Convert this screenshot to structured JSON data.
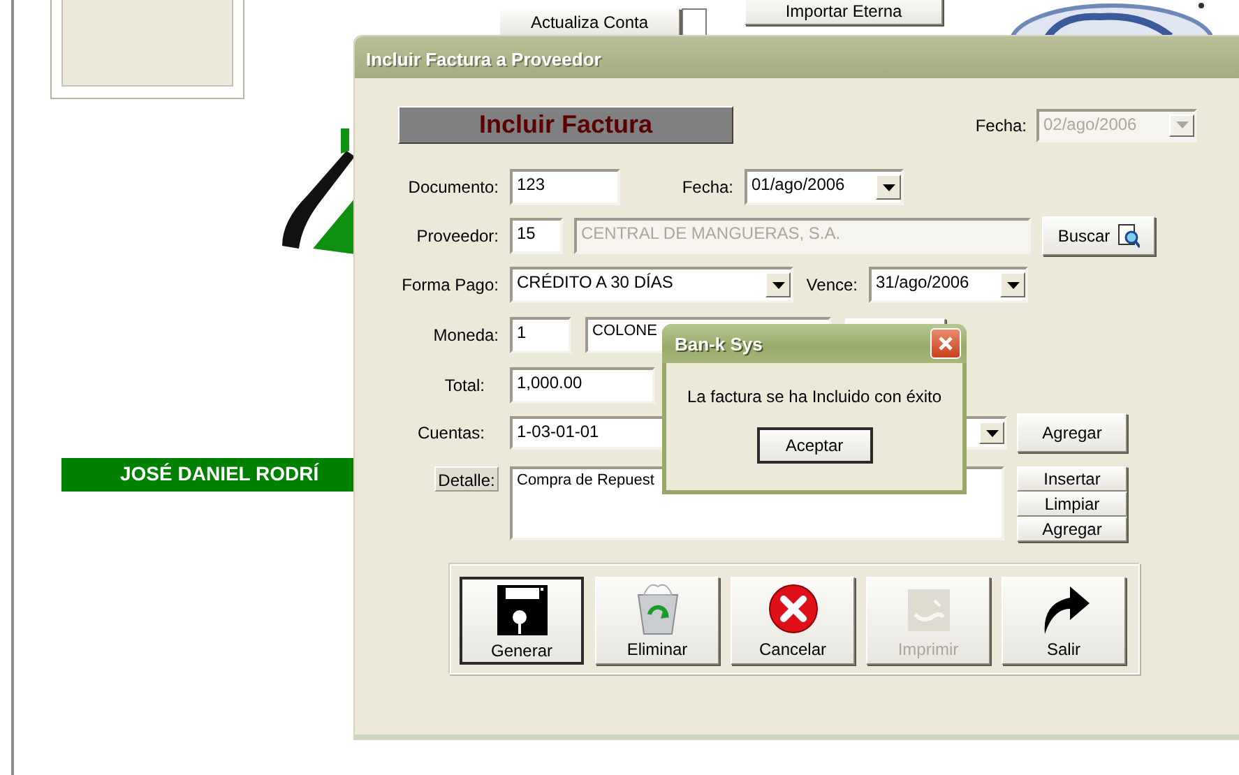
{
  "background": {
    "buttons": [
      "Actualiza Conta",
      "Importar Eterna"
    ],
    "user_name": "JOSÉ DANIEL RODRÍ"
  },
  "dialog": {
    "title": "Incluir Factura a Proveedor",
    "active": false,
    "heading": "Incluir Factura",
    "date": {
      "label": "Fecha:",
      "value": "02/ago/2006",
      "disabled": true
    },
    "documento": {
      "label": "Documento:",
      "value": "123"
    },
    "fecha": {
      "label": "Fecha:",
      "value": "01/ago/2006"
    },
    "proveedor": {
      "label": "Proveedor:",
      "code": "15",
      "name": "CENTRAL DE MANGUERAS, S.A.",
      "name_disabled": true,
      "button": "Buscar"
    },
    "forma_pago": {
      "label": "Forma Pago:",
      "value": "CRÉDITO A 30 DÍAS"
    },
    "vence": {
      "label": "Vence:",
      "value": "31/ago/2006"
    },
    "moneda": {
      "label": "Moneda:",
      "code": "1",
      "name": "COLONE"
    },
    "total": {
      "label": "Total:",
      "value": "1,000.00"
    },
    "cuentas": {
      "label": "Cuentas:",
      "value": "1-03-01-01",
      "button": "Agregar"
    },
    "detalle": {
      "label": "Detalle:",
      "value": "Compra de Repuest",
      "buttons": [
        "Insertar",
        "Limpiar",
        "Agregar"
      ]
    },
    "toolbar": [
      {
        "label": "Generar",
        "kind": "save",
        "default": true,
        "disabled": false
      },
      {
        "label": "Eliminar",
        "kind": "delete",
        "default": false,
        "disabled": false
      },
      {
        "label": "Cancelar",
        "kind": "cancel",
        "default": false,
        "disabled": false
      },
      {
        "label": "Imprimir",
        "kind": "print",
        "default": false,
        "disabled": true
      },
      {
        "label": "Salir",
        "kind": "exit",
        "default": false,
        "disabled": false
      }
    ]
  },
  "message_box": {
    "title": "Ban-k Sys",
    "text": "La factura se ha Incluido con éxito",
    "button": "Aceptar"
  }
}
